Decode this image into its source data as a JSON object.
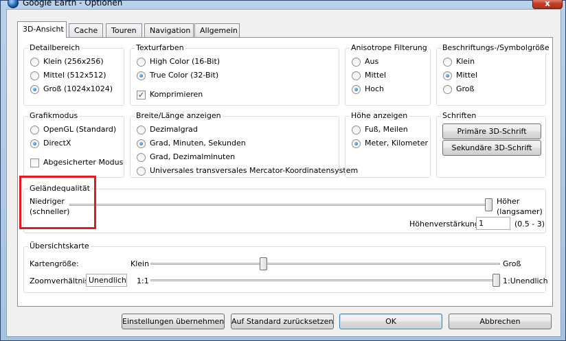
{
  "window": {
    "title": "Google Earth - Optionen",
    "close_glyph": "x"
  },
  "tabs": [
    {
      "label": "3D-Ansicht",
      "active": true
    },
    {
      "label": "Cache",
      "active": false
    },
    {
      "label": "Touren",
      "active": false
    },
    {
      "label": "Navigation",
      "active": false
    },
    {
      "label": "Allgemein",
      "active": false
    }
  ],
  "detailbereich": {
    "title": "Detailbereich",
    "options": [
      {
        "label": "Klein (256x256)",
        "checked": false
      },
      {
        "label": "Mittel (512x512)",
        "checked": false
      },
      {
        "label": "Groß (1024x1024)",
        "checked": true
      }
    ]
  },
  "texturfarben": {
    "title": "Texturfarben",
    "options": [
      {
        "label": "High Color (16-Bit)",
        "checked": false
      },
      {
        "label": "True Color (32-Bit)",
        "checked": true
      }
    ],
    "compress": {
      "label": "Komprimieren",
      "checked": true
    }
  },
  "anisotrope": {
    "title": "Anisotrope Filterung",
    "options": [
      {
        "label": "Aus",
        "checked": false
      },
      {
        "label": "Mittel",
        "checked": false
      },
      {
        "label": "Hoch",
        "checked": true
      }
    ]
  },
  "beschriftung": {
    "title": "Beschriftungs-/Symbolgröße",
    "options": [
      {
        "label": "Klein",
        "checked": false
      },
      {
        "label": "Mittel",
        "checked": true
      },
      {
        "label": "Groß",
        "checked": false
      }
    ]
  },
  "grafikmodus": {
    "title": "Grafikmodus",
    "options": [
      {
        "label": "OpenGL (Standard)",
        "checked": false
      },
      {
        "label": "DirectX",
        "checked": true
      }
    ],
    "safe_mode": {
      "label": "Abgesicherter Modus",
      "checked": false
    }
  },
  "breite_laenge": {
    "title": "Breite/Länge anzeigen",
    "options": [
      {
        "label": "Dezimalgrad",
        "checked": false
      },
      {
        "label": "Grad, Minuten, Sekunden",
        "checked": true
      },
      {
        "label": "Grad, Dezimalminuten",
        "checked": false
      },
      {
        "label": "Universales transversales Mercator-Koordinatensystem",
        "checked": false
      }
    ]
  },
  "hoehe": {
    "title": "Höhe anzeigen",
    "options": [
      {
        "label": "Fuß, Meilen",
        "checked": false
      },
      {
        "label": "Meter, Kilometer",
        "checked": true
      }
    ]
  },
  "schriften": {
    "title": "Schriften",
    "primary_button": "Primäre 3D-Schrift",
    "secondary_button": "Sekundäre 3D-Schrift"
  },
  "gelaende": {
    "title": "Geländequalität",
    "low_label_1": "Niedriger",
    "low_label_2": "(schneller)",
    "high_label_1": "Höher",
    "high_label_2": "(langsamer)",
    "quality_level": 1.0,
    "exaggeration_label": "Höhenverstärkung:",
    "exaggeration_value": "1",
    "exaggeration_range": "(0.5 - 3)"
  },
  "uebersichtskarte": {
    "title": "Übersichtskarte",
    "map_size_label": "Kartengröße:",
    "map_size_min": "Klein",
    "map_size_max": "Groß",
    "map_size_level": 0.32,
    "zoom_label": "Zoomverhältnis:",
    "zoom_value": "Unendlich",
    "zoom_min": "1:1",
    "zoom_max": "1:Unendlich",
    "zoom_level": 1.0
  },
  "buttons": {
    "apply": "Einstellungen übernehmen",
    "reset": "Auf Standard zurücksetzen",
    "ok": "OK",
    "cancel": "Abbrechen"
  },
  "colors": {
    "highlight": "#e21b23",
    "window_frame": "#b9d1ea"
  }
}
